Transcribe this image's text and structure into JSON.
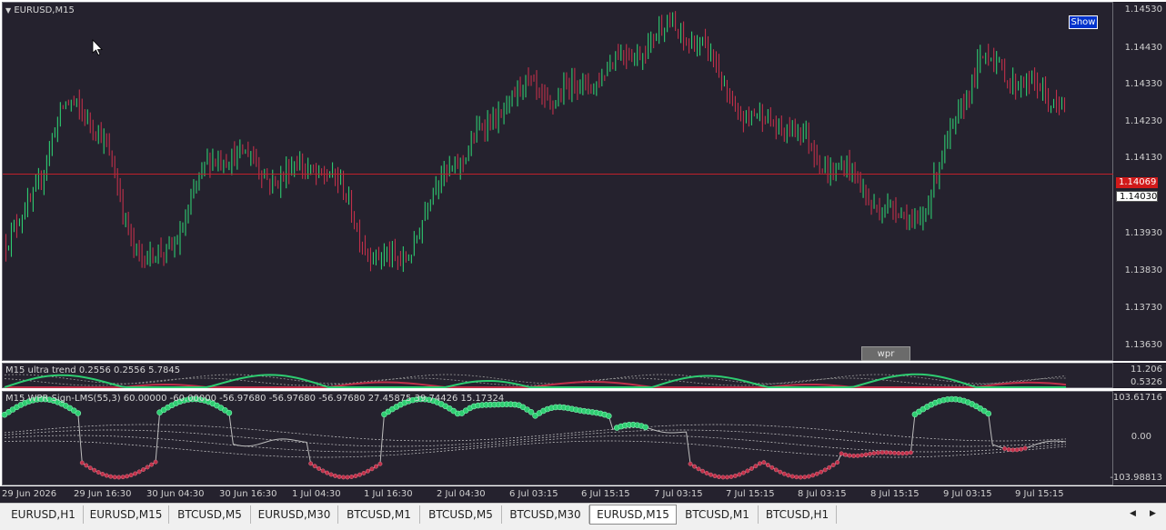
{
  "window": {
    "symbol_label": "EURUSD,M15"
  },
  "buttons": {
    "show": "Show",
    "wpr": "wpr"
  },
  "price_axis": {
    "labels": [
      "1.14530",
      "1.14430",
      "1.14330",
      "1.14230",
      "1.14130",
      "1.13930",
      "1.13830",
      "1.13730",
      "1.13630"
    ],
    "current_price_red": "1.14069",
    "current_price_white": "1.14030"
  },
  "trend_panel": {
    "title": "M15 ultra trend  0.2556 0.2556 5.7845",
    "axis_labels": [
      "11.206",
      "0.5326"
    ]
  },
  "wpr_panel": {
    "title": "M15 WPR  Sign-LMS(55,3) 60.00000 -60.00000 -56.97680 -56.97680 -56.97680 27.45875 39.74426 15.17324",
    "axis_labels": [
      "103.61716",
      "0.00",
      "-103.98813"
    ]
  },
  "time_axis": [
    "29 Jun 2026",
    "29 Jun 16:30",
    "30 Jun 04:30",
    "30 Jun 16:30",
    "1 Jul 04:30",
    "1 Jul 16:30",
    "2 Jul 04:30",
    "6 Jul 03:15",
    "6 Jul 15:15",
    "7 Jul 03:15",
    "7 Jul 15:15",
    "8 Jul 03:15",
    "8 Jul 15:15",
    "9 Jul 03:15",
    "9 Jul 15:15"
  ],
  "tabs": [
    "EURUSD,H1",
    "EURUSD,M15",
    "BTCUSD,M5",
    "EURUSD,M30",
    "BTCUSD,M1",
    "BTCUSD,M5",
    "BTCUSD,M30",
    "EURUSD,M15",
    "BTCUSD,M1",
    "BTCUSD,H1"
  ],
  "active_tab_index": 7,
  "colors": {
    "background": "#25222e",
    "bull": "#2ecc71",
    "bear": "#c0304a",
    "price_line": "#c0202a",
    "button_blue": "#0033cc"
  },
  "chart_data": {
    "type": "candlestick",
    "symbol": "EURUSD",
    "timeframe": "M15",
    "ylim": [
      1.1358,
      1.1454
    ],
    "x": [
      "29 Jun 2026",
      "29 Jun 16:30",
      "30 Jun 04:30",
      "30 Jun 16:30",
      "1 Jul 04:30",
      "1 Jul 16:30",
      "2 Jul 04:30",
      "6 Jul 03:15",
      "6 Jul 15:15",
      "7 Jul 03:15",
      "7 Jul 15:15",
      "8 Jul 03:15",
      "8 Jul 15:15",
      "9 Jul 03:15",
      "9 Jul 15:15"
    ],
    "close": [
      1.1387,
      1.1426,
      1.1383,
      1.1412,
      1.141,
      1.138,
      1.1414,
      1.1428,
      1.144,
      1.1444,
      1.1425,
      1.1405,
      1.1398,
      1.1435,
      1.1432
    ],
    "current_price": 1.14069
  }
}
